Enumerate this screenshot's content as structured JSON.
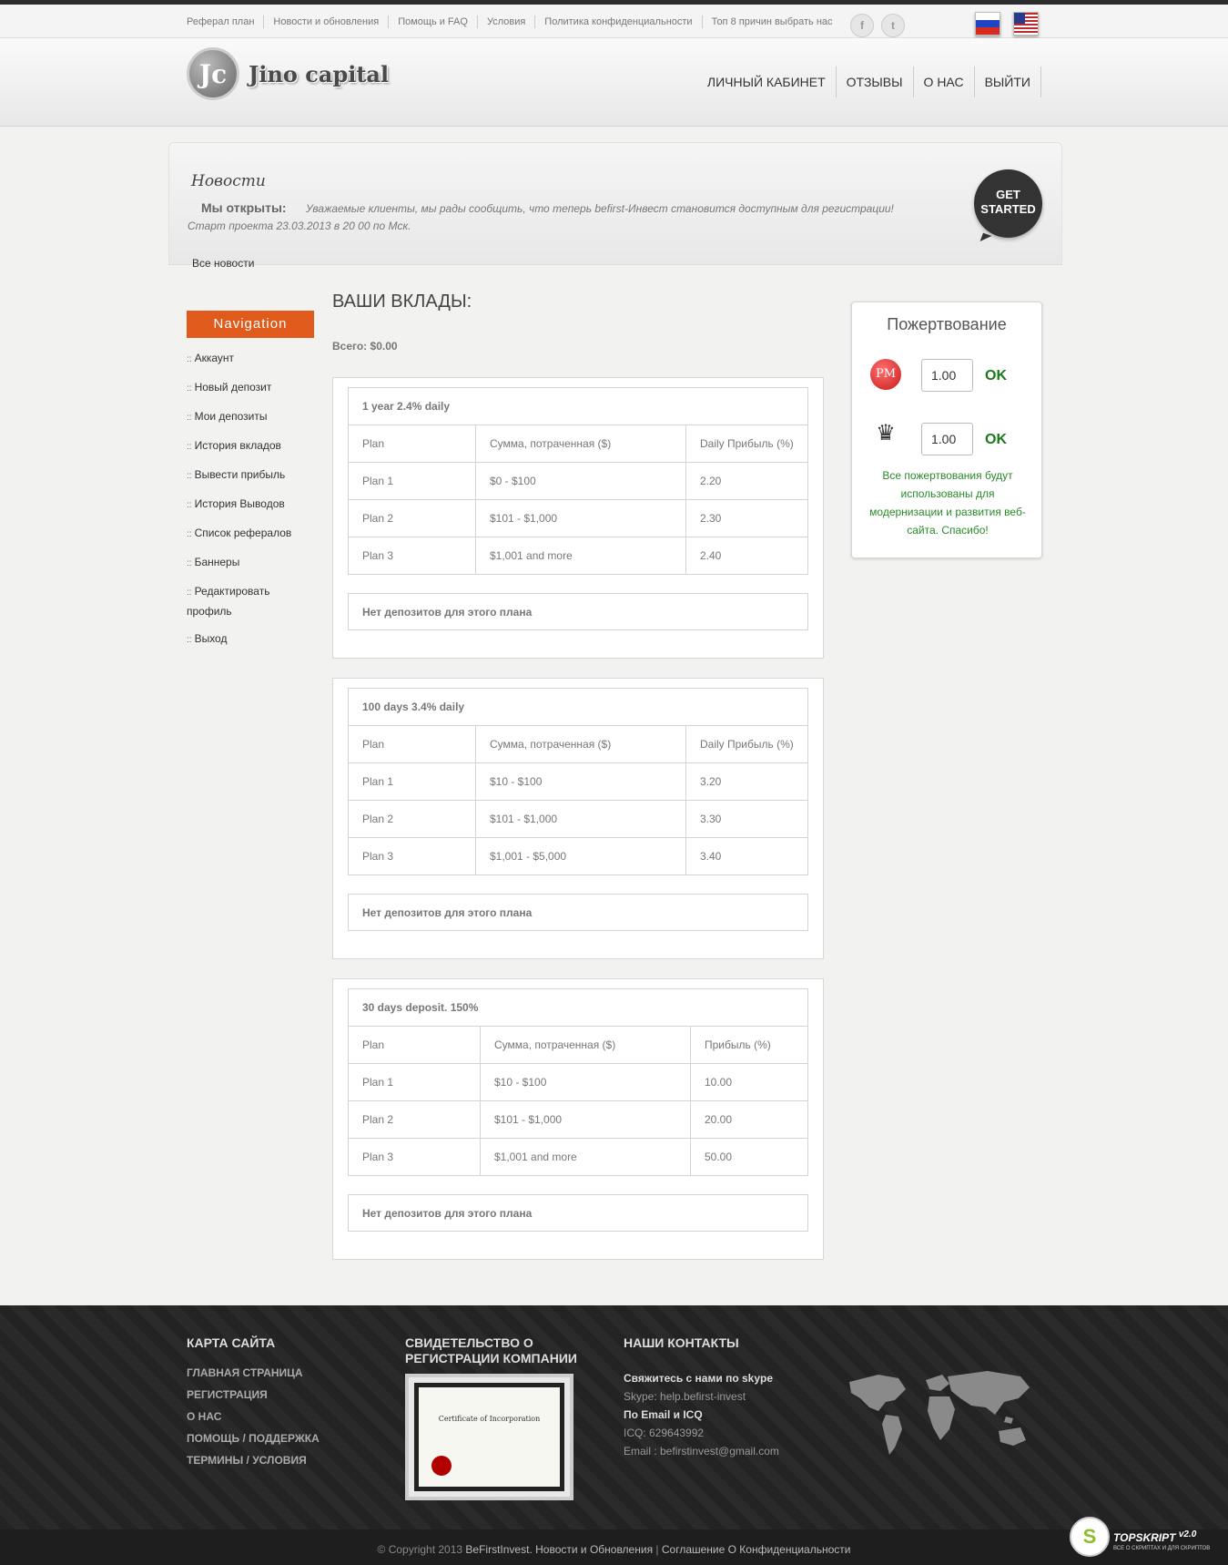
{
  "toplinks": [
    "Реферал план",
    "Новости и обновления",
    "Помощь и FAQ",
    "Условия",
    "Политика конфиденциальности",
    "Топ 8 причин выбрать нас"
  ],
  "social": {
    "facebook": "f",
    "twitter": "t"
  },
  "logo": {
    "mark": "Jc",
    "text": "Jino capital"
  },
  "mainnav": [
    "ЛИЧНЫЙ КАБИНЕТ",
    "ОТЗЫВЫ",
    "О НАС",
    "ВЫЙТИ"
  ],
  "news": {
    "title": "Новости",
    "headline": "Мы открыты:",
    "body": "Уважаемые клиенты, мы рады сообщить, что теперь befirst-Инвест становится доступным для регистрации!",
    "body2": "Старт проекта 23.03.2013 в 20 00 по Мск.",
    "all": "Все новости",
    "get_started_1": "GET",
    "get_started_2": "STARTED"
  },
  "sidebar": {
    "title": "Navigation",
    "items": [
      "Аккаунт",
      "Новый депозит",
      "Мои депозиты",
      "История вкладов",
      "Вывести прибыль",
      "История Выводов",
      "Список рефералов",
      "Баннеры",
      "Редактировать профиль",
      "Выход"
    ]
  },
  "main": {
    "title": "ВАШИ ВКЛАДЫ:",
    "total": "Всего: $0.00"
  },
  "plans": [
    {
      "name": "1 year 2.4% daily",
      "cols": [
        "Plan",
        "Сумма, потраченная ($)",
        "Daily Прибыль (%)"
      ],
      "rows": [
        [
          "Plan 1",
          "$0 - $100",
          "2.20"
        ],
        [
          "Plan 2",
          "$101 - $1,000",
          "2.30"
        ],
        [
          "Plan 3",
          "$1,001 and more",
          "2.40"
        ]
      ],
      "nodep": "Нет депозитов для этого плана"
    },
    {
      "name": "100 days 3.4% daily",
      "cols": [
        "Plan",
        "Сумма, потраченная ($)",
        "Daily Прибыль (%)"
      ],
      "rows": [
        [
          "Plan 1",
          "$10 - $100",
          "3.20"
        ],
        [
          "Plan 2",
          "$101 - $1,000",
          "3.30"
        ],
        [
          "Plan 3",
          "$1,001 - $5,000",
          "3.40"
        ]
      ],
      "nodep": "Нет депозитов для этого плана"
    },
    {
      "name": "30 days deposit. 150%",
      "cols": [
        "Plan",
        "Сумма, потраченная ($)",
        "Прибыль (%)"
      ],
      "rows": [
        [
          "Plan 1",
          "$10 - $100",
          "10.00"
        ],
        [
          "Plan 2",
          "$101 - $1,000",
          "20.00"
        ],
        [
          "Plan 3",
          "$1,001 and more",
          "50.00"
        ]
      ],
      "nodep": "Нет депозитов для этого плана"
    }
  ],
  "donate": {
    "title": "Пожертвование",
    "pm_label": "PM",
    "amount1": "1.00",
    "amount2": "1.00",
    "ok": "OK",
    "text": "Все пожертвования будут использованы для модернизации и развития веб-сайта. Спасибо!"
  },
  "footer": {
    "sitemap_title": "КАРТА САЙТА",
    "sitemap": [
      "ГЛАВНАЯ СТРАНИЦА",
      "РЕГИСТРАЦИЯ",
      "О НАС",
      "ПОМОЩЬ / ПОДДЕРЖКА",
      "ТЕРМИНЫ / УСЛОВИЯ"
    ],
    "cert_title": "СВИДЕТЕЛЬСТВО О РЕГИСТРАЦИИ КОМПАНИИ",
    "cert_text": "Certificate of Incorporation",
    "contacts_title": "НАШИ КОНТАКТЫ",
    "skype_label": "Свяжитесь с нами по skype",
    "skype": "Skype: help.befirst-invest",
    "email_label": "По Email и ICQ",
    "icq": "ICQ: 629643992",
    "email": "Email : befirstinvest@gmail.com"
  },
  "bottom": {
    "copyright": "© Copyright 2013",
    "brand": "BeFirstInvest.",
    "news": "Новости и Обновления",
    "sep": "|",
    "agreement": "Соглашение О Конфиденциальности"
  },
  "topskript": {
    "mark": "S",
    "name": "TOPSKRIPT",
    "version": "v2.0",
    "tagline": "ВСЕ О СКРИПТАХ И ДЛЯ СКРИПТОВ"
  }
}
